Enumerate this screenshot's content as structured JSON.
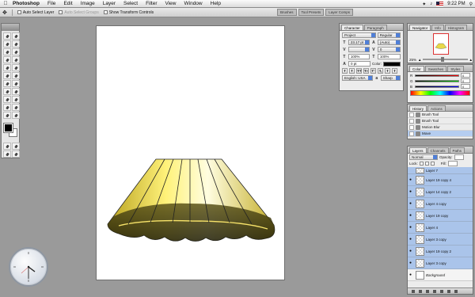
{
  "menubar": {
    "app": "Photoshop",
    "items": [
      "File",
      "Edit",
      "Image",
      "Layer",
      "Select",
      "Filter",
      "View",
      "Window",
      "Help"
    ],
    "time": "9:22 PM"
  },
  "options": {
    "auto_select_layer": "Auto Select Layer",
    "auto_select_groups": "Auto Select Groups",
    "show_transform": "Show Transform Controls",
    "palette_tabs": [
      "Brushes",
      "Tool Presets",
      "Layer Comps"
    ]
  },
  "character": {
    "tabs": [
      "Character",
      "Paragraph"
    ],
    "font": "Project",
    "style": "Regular",
    "size": "23.17 pt",
    "leading": "(Auto)",
    "kerning": "",
    "tracking": "0",
    "vscale": "100%",
    "hscale": "100%",
    "baseline": "0 pt",
    "color_label": "Color:",
    "language": "English: USA",
    "aa": "Sharp",
    "style_buttons": [
      "T",
      "T",
      "TT",
      "Tт",
      "T¹",
      "T,",
      "T",
      "T"
    ]
  },
  "navigator": {
    "tabs": [
      "Navigator",
      "Info",
      "Histogram"
    ],
    "zoom": "25%"
  },
  "colorpanel": {
    "tabs": [
      "Color",
      "Swatches",
      "Styles"
    ],
    "channels": [
      {
        "label": "R",
        "value": "0"
      },
      {
        "label": "G",
        "value": "0"
      },
      {
        "label": "B",
        "value": "0"
      }
    ],
    "colors": {
      "fg": "#000000",
      "bg": "#ffffff"
    }
  },
  "history": {
    "tabs": [
      "History",
      "Actions"
    ],
    "items": [
      {
        "label": "Brush Tool"
      },
      {
        "label": "Brush Tool"
      },
      {
        "label": "Motion Blur"
      },
      {
        "label": "Move"
      }
    ]
  },
  "layers": {
    "tabs": [
      "Layers",
      "Channels",
      "Paths"
    ],
    "blend": "Normal",
    "opacity": "Opacity:",
    "fill": "Fill:",
    "lock_label": "Lock:",
    "items": [
      {
        "name": "Layer 7"
      },
      {
        "name": "Layer 19 copy 4"
      },
      {
        "name": "Layer 14 copy 2"
      },
      {
        "name": "Layer 4 copy"
      },
      {
        "name": "Layer 19 copy"
      },
      {
        "name": "Layer 4"
      },
      {
        "name": "Layer 3 copy"
      },
      {
        "name": "Layer 19 copy 2"
      },
      {
        "name": "Layer 3 copy"
      },
      {
        "name": "Background"
      }
    ]
  }
}
